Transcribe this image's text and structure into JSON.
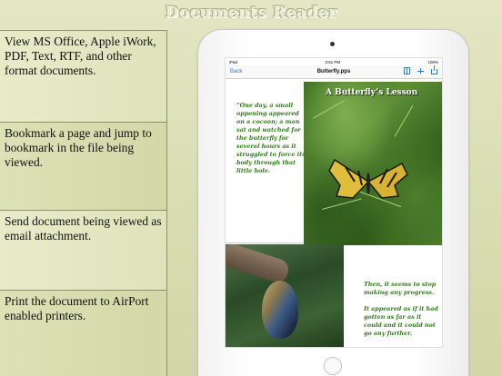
{
  "app": {
    "title": "Documents Reader"
  },
  "features": [
    {
      "text": "View MS Office, Apple iWork, PDF, Text, RTF, and other format documents."
    },
    {
      "text": "Bookmark a page and  jump to bookmark in the file being viewed."
    },
    {
      "text": "Send document being viewed as email attachment."
    },
    {
      "text": "Print the document to AirPort enabled printers."
    }
  ],
  "device": {
    "status": {
      "carrier": "iPad",
      "time": "3:51 PM",
      "battery": "100%"
    },
    "nav": {
      "back_label": "Back",
      "title": "Butterfly.pps",
      "icons": [
        "bookmarks-icon",
        "add-icon",
        "share-icon"
      ]
    }
  },
  "document": {
    "slide1": {
      "heading": "A Butterfly’s Lesson",
      "quote": "”One day, a small oppening appeared on a cocoon; a man sat and watched for the butterfly for several hours as it struggled to force its body through that little hole."
    },
    "slide2": {
      "quote": "Then, it seems to stop making any progress.\n\nIt appeared as if it had gotten as far as it could and it could not go any further."
    }
  },
  "colors": {
    "accent": "#2a7bd6",
    "quote_text": "#2f7a18",
    "panel_border": "#8d916c"
  }
}
